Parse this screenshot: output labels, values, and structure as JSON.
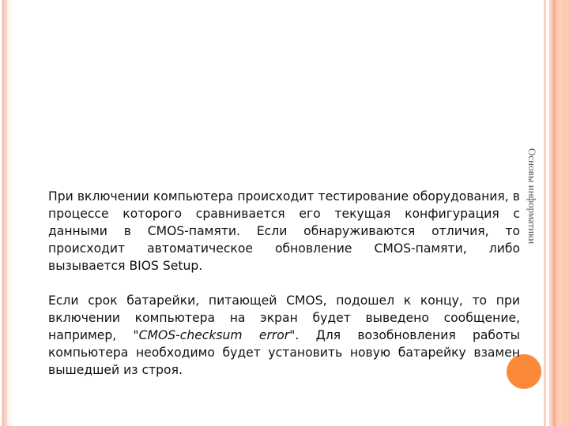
{
  "slide": {
    "side_title": "Основы информатики",
    "paragraphs": [
      {
        "text": "При включении компьютера происходит тестирование оборудования, в процессе которого сравнивается его текущая конфигурация с данными в CMOS-памяти. Если обнаруживаются отличия, то происходит автоматическое обновление CMOS-памяти, либо вызывается BIOS Setup."
      },
      {
        "text_before": "Если срок батарейки, питающей CMOS, подошел к концу, то при включении компьютера на экран будет выведено сообщение, например, \"",
        "text_italic": "CMOS-checksum error",
        "text_after": "\". Для возобновления работы компьютера необходимо будет установить новую батарейку взамен вышедшей из строя."
      }
    ]
  },
  "colors": {
    "accent_circle": "#fa8a3a",
    "stripe_right": "#fcc8b1",
    "stripe_left": "#f8c0b0",
    "text": "#111111",
    "side_title": "#5a5a5a"
  }
}
